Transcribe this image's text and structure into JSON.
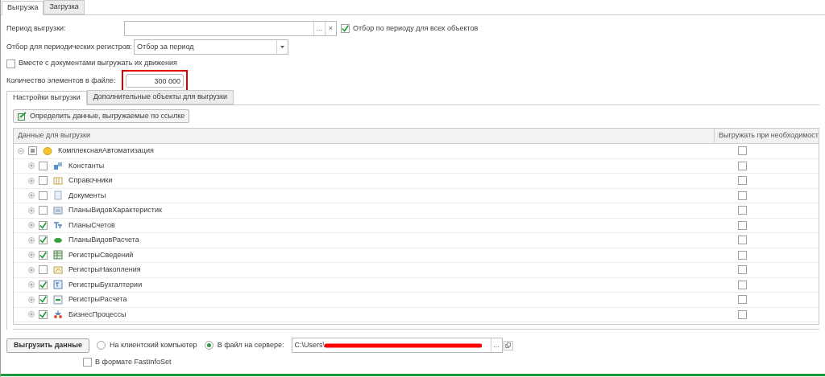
{
  "tabs": [
    {
      "label": "Выгрузка",
      "selected": true
    },
    {
      "label": "Загрузка",
      "selected": false
    }
  ],
  "period": {
    "label": "Период выгрузки:",
    "select_button": "...",
    "clear_button": "×"
  },
  "period_all": {
    "label": "Отбор по периоду для всех объектов",
    "checked": true
  },
  "periodic_filter": {
    "label": "Отбор для периодических регистров:",
    "value": "Отбор за период"
  },
  "with_movements": {
    "label": "Вместе с документами выгружать их движения",
    "checked": false
  },
  "count": {
    "label": "Количество элементов в файле:",
    "value": "300 000",
    "highlighted": true
  },
  "inner_tabs": [
    {
      "label": "Настройки выгрузки",
      "selected": true
    },
    {
      "label": "Дополнительные объекты для выгрузки",
      "selected": false
    }
  ],
  "define_button": "Определить данные, выгружаемые по ссылке",
  "table": {
    "columns": [
      "Данные для выгрузки",
      "Выгружать при необходимост"
    ],
    "root": {
      "name": "КомплекснаяАвтоматизация",
      "expanded": true,
      "partial": true,
      "on_demand": false
    },
    "rows": [
      {
        "name": "Константы",
        "expanded": false,
        "checked": false,
        "on_demand": false
      },
      {
        "name": "Справочники",
        "expanded": false,
        "checked": false,
        "on_demand": false
      },
      {
        "name": "Документы",
        "expanded": false,
        "checked": false,
        "on_demand": false
      },
      {
        "name": "ПланыВидовХарактеристик",
        "expanded": false,
        "checked": false,
        "on_demand": false
      },
      {
        "name": "ПланыСчетов",
        "expanded": false,
        "checked": true,
        "on_demand": false
      },
      {
        "name": "ПланыВидовРасчета",
        "expanded": false,
        "checked": true,
        "on_demand": false
      },
      {
        "name": "РегистрыСведений",
        "expanded": false,
        "checked": true,
        "on_demand": false
      },
      {
        "name": "РегистрыНакопления",
        "expanded": false,
        "checked": false,
        "on_demand": false
      },
      {
        "name": "РегистрыБухгалтерии",
        "expanded": false,
        "checked": true,
        "on_demand": false
      },
      {
        "name": "РегистрыРасчета",
        "expanded": false,
        "checked": true,
        "on_demand": false
      },
      {
        "name": "БизнесПроцессы",
        "expanded": false,
        "checked": true,
        "on_demand": false
      }
    ]
  },
  "export_button": "Выгрузить данные",
  "destinations": [
    {
      "label": "На клиентский компьютер",
      "selected": false
    },
    {
      "label": "В файл на сервере:",
      "selected": true
    }
  ],
  "server_path": {
    "value": "C:\\Users\\",
    "redacted": true,
    "select_button": "..."
  },
  "fastinfoset": {
    "label": "В формате FastInfoSet",
    "checked": false
  }
}
